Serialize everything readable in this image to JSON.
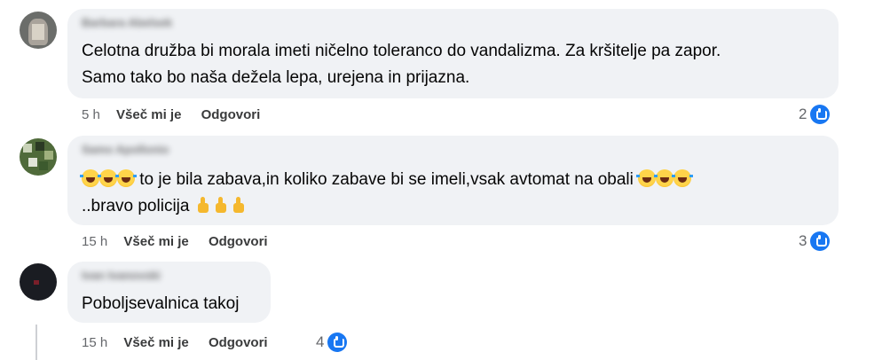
{
  "comments": [
    {
      "author": "Barbara Abelsek",
      "lines": [
        "Celotna družba bi morala imeti ničelno toleranco do vandalizma. Za kršitelje pa zapor.",
        "Samo tako bo naša dežela lepa, urejena in prijazna."
      ],
      "time": "5 h",
      "like_label": "Všeč mi je",
      "reply_label": "Odgovori",
      "reaction_count": "2"
    },
    {
      "author": "Samo Apollonio",
      "line1_text": " to je bila zabava,in koliko zabave bi se imeli,vsak avtomat na obali ",
      "line2_text": "..bravo policija ",
      "time": "15 h",
      "like_label": "Všeč mi je",
      "reply_label": "Odgovori",
      "reaction_count": "3"
    },
    {
      "author": "Ivan Ivanovski",
      "lines": [
        "Poboljsevalnica takoj"
      ],
      "time": "15 h",
      "like_label": "Všeč mi je",
      "reply_label": "Odgovori",
      "reaction_count": "4"
    }
  ],
  "icons": {
    "reaction": "like-icon",
    "emoji_laugh": "rolling-on-floor-laughing-emoji",
    "emoji_thumb": "thumbs-up-emoji"
  },
  "colors": {
    "accent": "#1877f2",
    "bubble": "#f0f2f5",
    "meta": "#65676b"
  }
}
